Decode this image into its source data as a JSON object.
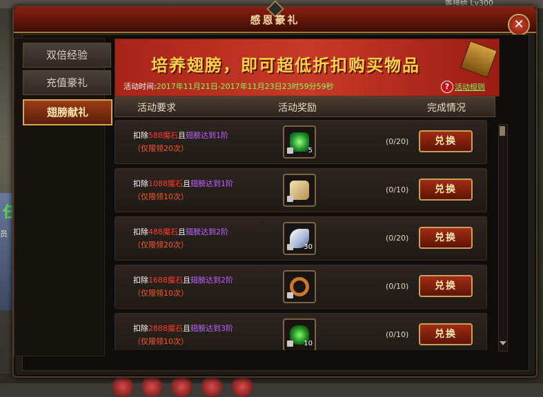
{
  "background": {
    "top_right_text": "等排给 Lv300",
    "left_fragment": "员",
    "left_glyph": "任"
  },
  "window": {
    "title": "感恩豪礼",
    "close_icon": "close-icon"
  },
  "sidebar": {
    "tabs": [
      {
        "label": "双倍经验",
        "active": false
      },
      {
        "label": "充值豪礼",
        "active": false
      },
      {
        "label": "翅膀献礼",
        "active": true
      }
    ]
  },
  "banner": {
    "title": "培养翅膀，即可超低折扣购买物品",
    "time_label": "活动时间:",
    "time_value": "2017年11月21日-2017年11月23日23时59分59秒",
    "rules_link": "活动规则"
  },
  "table": {
    "headers": {
      "requirement": "活动要求",
      "reward": "活动奖励",
      "status": "完成情况"
    },
    "exchange_label": "兑换",
    "rows": [
      {
        "prefix": "扣除",
        "cost": "588魔石",
        "mid": "且",
        "condition": "翅膀达到1阶",
        "limit": "（仅限领20次）",
        "qty": "5",
        "progress": "(0/20)",
        "item_icon": "green-gem-icon"
      },
      {
        "prefix": "扣除",
        "cost": "1088魔石",
        "mid": "且",
        "condition": "翅膀达到1阶",
        "limit": "（仅限领10次）",
        "qty": "",
        "progress": "(0/10)",
        "item_icon": "scroll-icon"
      },
      {
        "prefix": "扣除",
        "cost": "488魔石",
        "mid": "且",
        "condition": "翅膀达到2阶",
        "limit": "（仅限领20次）",
        "qty": "30",
        "progress": "(0/20)",
        "item_icon": "feather-icon"
      },
      {
        "prefix": "扣除",
        "cost": "1688魔石",
        "mid": "且",
        "condition": "翅膀达到2阶",
        "limit": "（仅限领10次）",
        "qty": "",
        "progress": "(0/10)",
        "item_icon": "bronze-ring-icon"
      },
      {
        "prefix": "扣除",
        "cost": "2888魔石",
        "mid": "且",
        "condition": "翅膀达到3阶",
        "limit": "（仅限领10次）",
        "qty": "10",
        "progress": "(0/10)",
        "item_icon": "green-crystal-icon"
      }
    ]
  },
  "colors": {
    "cost": "#ff3a2a",
    "condition": "#c062ff",
    "limit": "#ff5a2a",
    "timestamp": "#7dff5a",
    "accent_gold": "#caa05a"
  }
}
